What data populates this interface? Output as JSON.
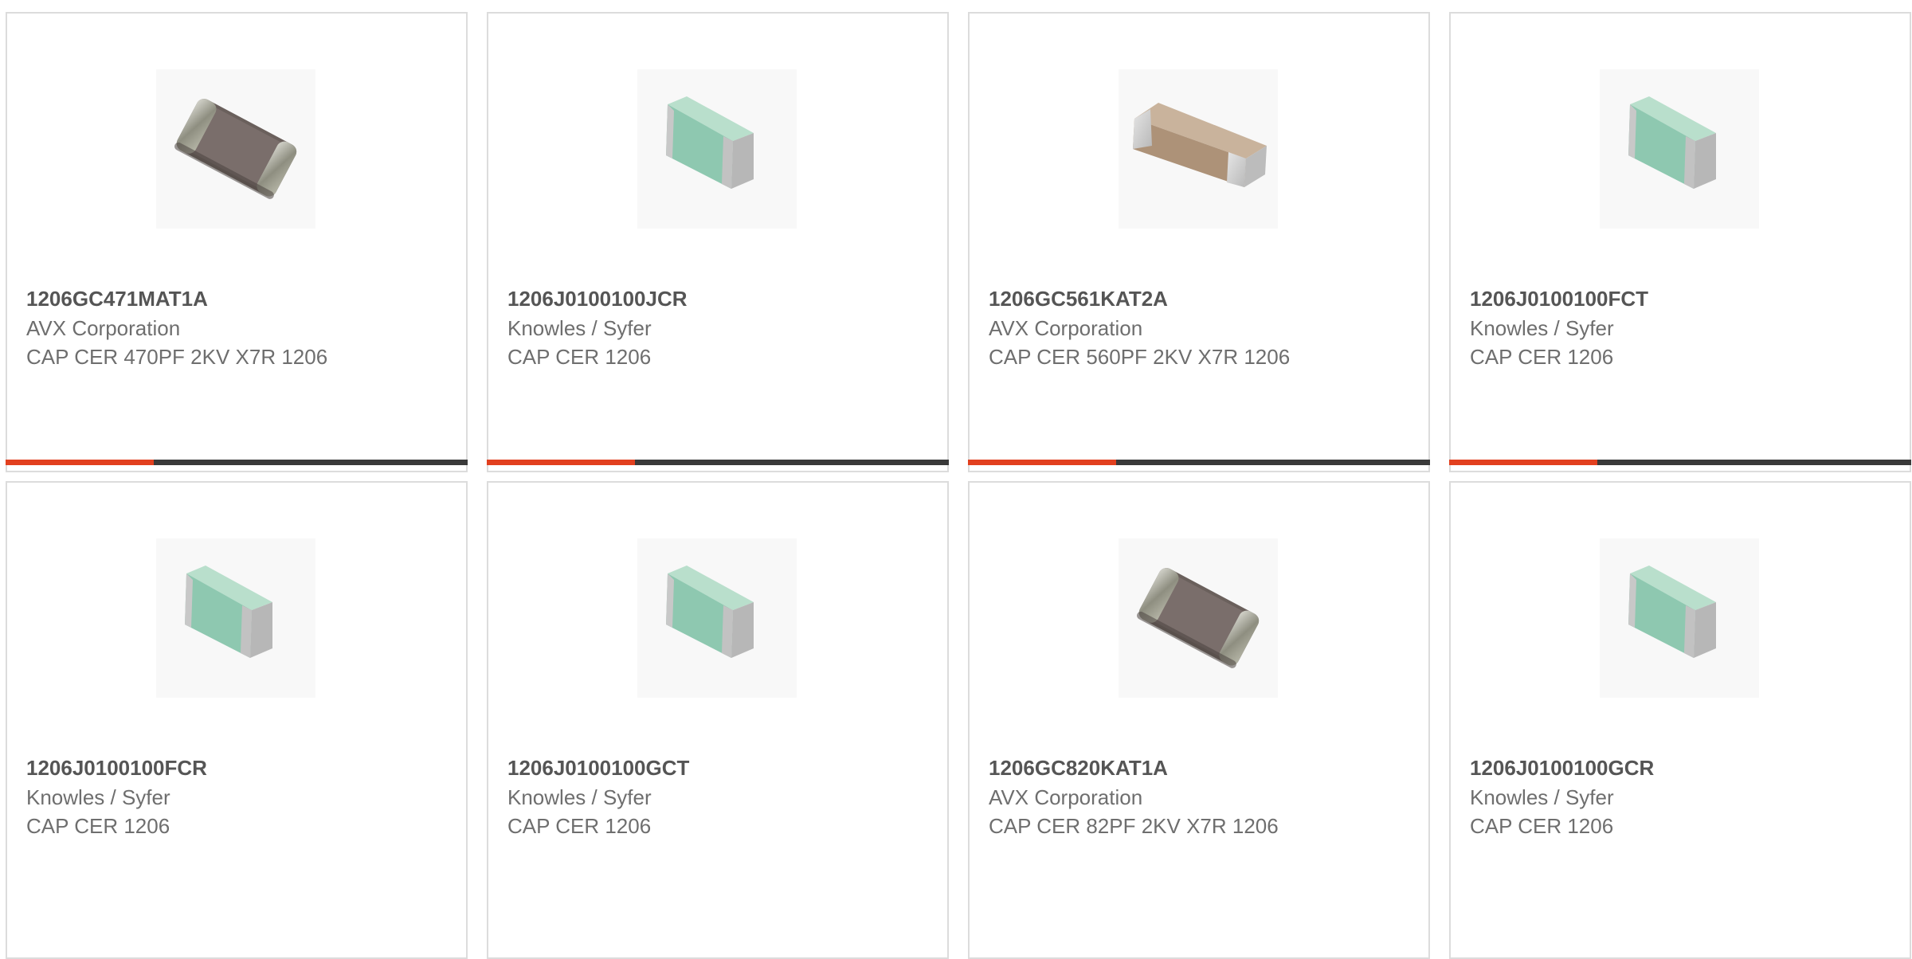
{
  "products": [
    {
      "part": "1206GC471MAT1A",
      "manufacturer": "AVX Corporation",
      "description": "CAP CER 470PF 2KV X7R 1206",
      "image_icon": "ceramic-chip-dark-icon",
      "progress": 0.32
    },
    {
      "part": "1206J0100100JCR",
      "manufacturer": "Knowles / Syfer",
      "description": "CAP CER 1206",
      "image_icon": "ceramic-chip-green-icon",
      "progress": 0.32
    },
    {
      "part": "1206GC561KAT2A",
      "manufacturer": "AVX Corporation",
      "description": "CAP CER 560PF 2KV X7R 1206",
      "image_icon": "ceramic-chip-tan-icon",
      "progress": 0.32
    },
    {
      "part": "1206J0100100FCT",
      "manufacturer": "Knowles / Syfer",
      "description": "CAP CER 1206",
      "image_icon": "ceramic-chip-green-icon",
      "progress": 0.32
    },
    {
      "part": "1206J0100100FCR",
      "manufacturer": "Knowles / Syfer",
      "description": "CAP CER 1206",
      "image_icon": "ceramic-chip-green-icon"
    },
    {
      "part": "1206J0100100GCT",
      "manufacturer": "Knowles / Syfer",
      "description": "CAP CER 1206",
      "image_icon": "ceramic-chip-green-icon"
    },
    {
      "part": "1206GC820KAT1A",
      "manufacturer": "AVX Corporation",
      "description": "CAP CER 82PF 2KV X7R 1206",
      "image_icon": "ceramic-chip-dark-icon"
    },
    {
      "part": "1206J0100100GCR",
      "manufacturer": "Knowles / Syfer",
      "description": "CAP CER 1206",
      "image_icon": "ceramic-chip-green-icon"
    }
  ],
  "colors": {
    "accent": "#e2401f",
    "bar_track": "#3a3a3a",
    "card_border": "#dcdcdc",
    "part_text": "#555555",
    "meta_text": "#6e6e6e"
  }
}
